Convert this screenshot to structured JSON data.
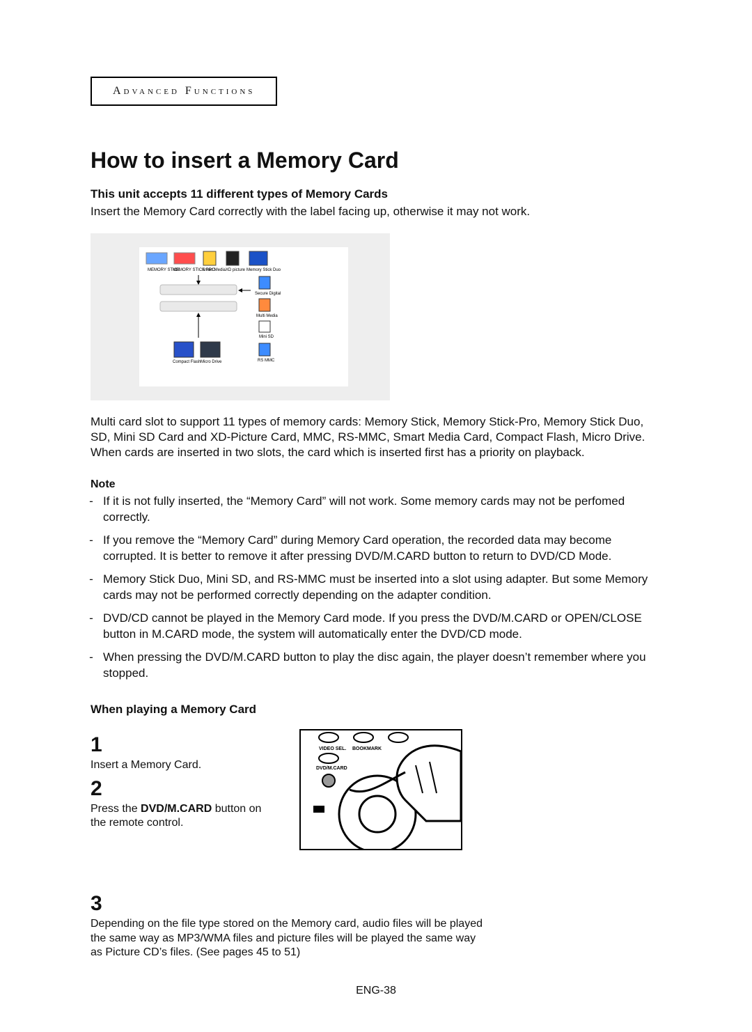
{
  "section_label": "Advanced Functions",
  "title": "How to insert a Memory Card",
  "subtitle": "This unit accepts 11 different types of Memory Cards",
  "intro": "Insert the Memory Card correctly with the label facing up, otherwise it may not work.",
  "cards_diagram": {
    "top_row": [
      "MEMORY STICK",
      "MEMORY STICK PRO",
      "Smart Media",
      "XD picture",
      "Memory Stick Duo"
    ],
    "right_col": [
      "Secure Digital",
      "Multi Media",
      "Mini SD",
      "RS MMC"
    ],
    "bottom_row": [
      "Compact Flash",
      "Micro Drive"
    ]
  },
  "multi_slot_text": "Multi card slot to support 11 types of memory cards: Memory Stick, Memory Stick-Pro, Memory Stick Duo, SD, Mini SD Card and XD-Picture Card, MMC, RS-MMC, Smart Media Card, Compact Flash, Micro Drive. When cards are inserted in two slots, the card which is inserted first has a priority on playback.",
  "note_label": "Note",
  "notes": [
    "If it is not fully inserted, the “Memory Card” will not work. Some memory cards may not be perfomed correctly.",
    "If you remove the “Memory Card” during Memory Card operation, the recorded data may become corrupted. It is better to remove it after pressing DVD/M.CARD button to return to DVD/CD Mode.",
    "Memory Stick Duo, Mini SD, and RS-MMC must be inserted into a slot using adapter. But some Memory cards may not be performed correctly depending on the adapter condition.",
    "DVD/CD cannot be played in the Memory Card mode. If you press the DVD/M.CARD or OPEN/CLOSE button in M.CARD mode, the system will automatically enter the DVD/CD mode.",
    "When pressing the DVD/M.CARD button to play the disc again, the player doesn’t remember where you stopped."
  ],
  "play_heading": "When playing a Memory Card",
  "steps": {
    "s1_num": "1",
    "s1_text": "Insert a Memory Card.",
    "s2_num": "2",
    "s2_text_pre": "Press the ",
    "s2_text_bold": "DVD/M.CARD",
    "s2_text_post": " button on the remote control.",
    "s3_num": "3",
    "s3_text": "Depending on the file type stored on the Memory card, audio files will be played the same way as MP3/WMA files and picture files will be played the same way as Picture CD’s files. (See pages 45 to 51)"
  },
  "remote_labels": {
    "video_sel": "VIDEO SEL.",
    "bookmark": "BOOKMARK",
    "dvd_mcard": "DVD/M.CARD"
  },
  "footer": "ENG-38"
}
